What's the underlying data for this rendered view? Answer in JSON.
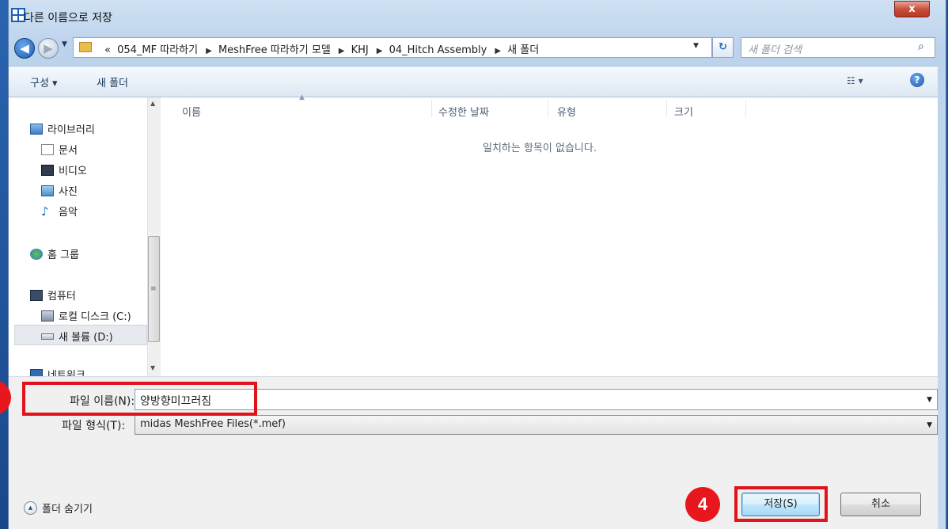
{
  "window": {
    "title": "다른 이름으로 저장",
    "close_label": "x"
  },
  "address": {
    "prefix": "«",
    "crumbs": [
      "054_MF 따라하기",
      "MeshFree 따라하기 모델",
      "KHJ",
      "04_Hitch Assembly",
      "새 폴더"
    ],
    "search_placeholder": "새 폴더 검색"
  },
  "toolbar": {
    "organize": "구성 ▾",
    "new_folder": "새 폴더",
    "view_icon": "views-icon",
    "help": "?"
  },
  "nav": {
    "items": [
      {
        "label": "라이브러리",
        "icon": "libraries-icon"
      },
      {
        "label": "문서",
        "icon": "documents-icon"
      },
      {
        "label": "비디오",
        "icon": "videos-icon"
      },
      {
        "label": "사진",
        "icon": "pictures-icon"
      },
      {
        "label": "음악",
        "icon": "music-icon"
      },
      {
        "label": "홈 그룹",
        "icon": "homegroup-icon"
      },
      {
        "label": "컴퓨터",
        "icon": "computer-icon"
      },
      {
        "label": "로컬 디스크 (C:)",
        "icon": "local-disk-icon"
      },
      {
        "label": "새 볼륨 (D:)",
        "icon": "drive-icon"
      },
      {
        "label": "네트워크",
        "icon": "network-icon"
      }
    ]
  },
  "file_list": {
    "columns": [
      "이름",
      "수정한 날짜",
      "유형",
      "크기"
    ],
    "empty_message": "일치하는 항목이 없습니다."
  },
  "save_form": {
    "filename_label": "파일 이름(N):",
    "filename_value": "양방향미끄러짐",
    "filetype_label": "파일 형식(T):",
    "filetype_value": "midas MeshFree Files(*.mef)"
  },
  "footer": {
    "hide_folders": "폴더 숨기기",
    "save_button": "저장(S)",
    "cancel_button": "취소"
  },
  "annotations": {
    "step_badge": "4",
    "highlight_color": "#e0131a"
  }
}
